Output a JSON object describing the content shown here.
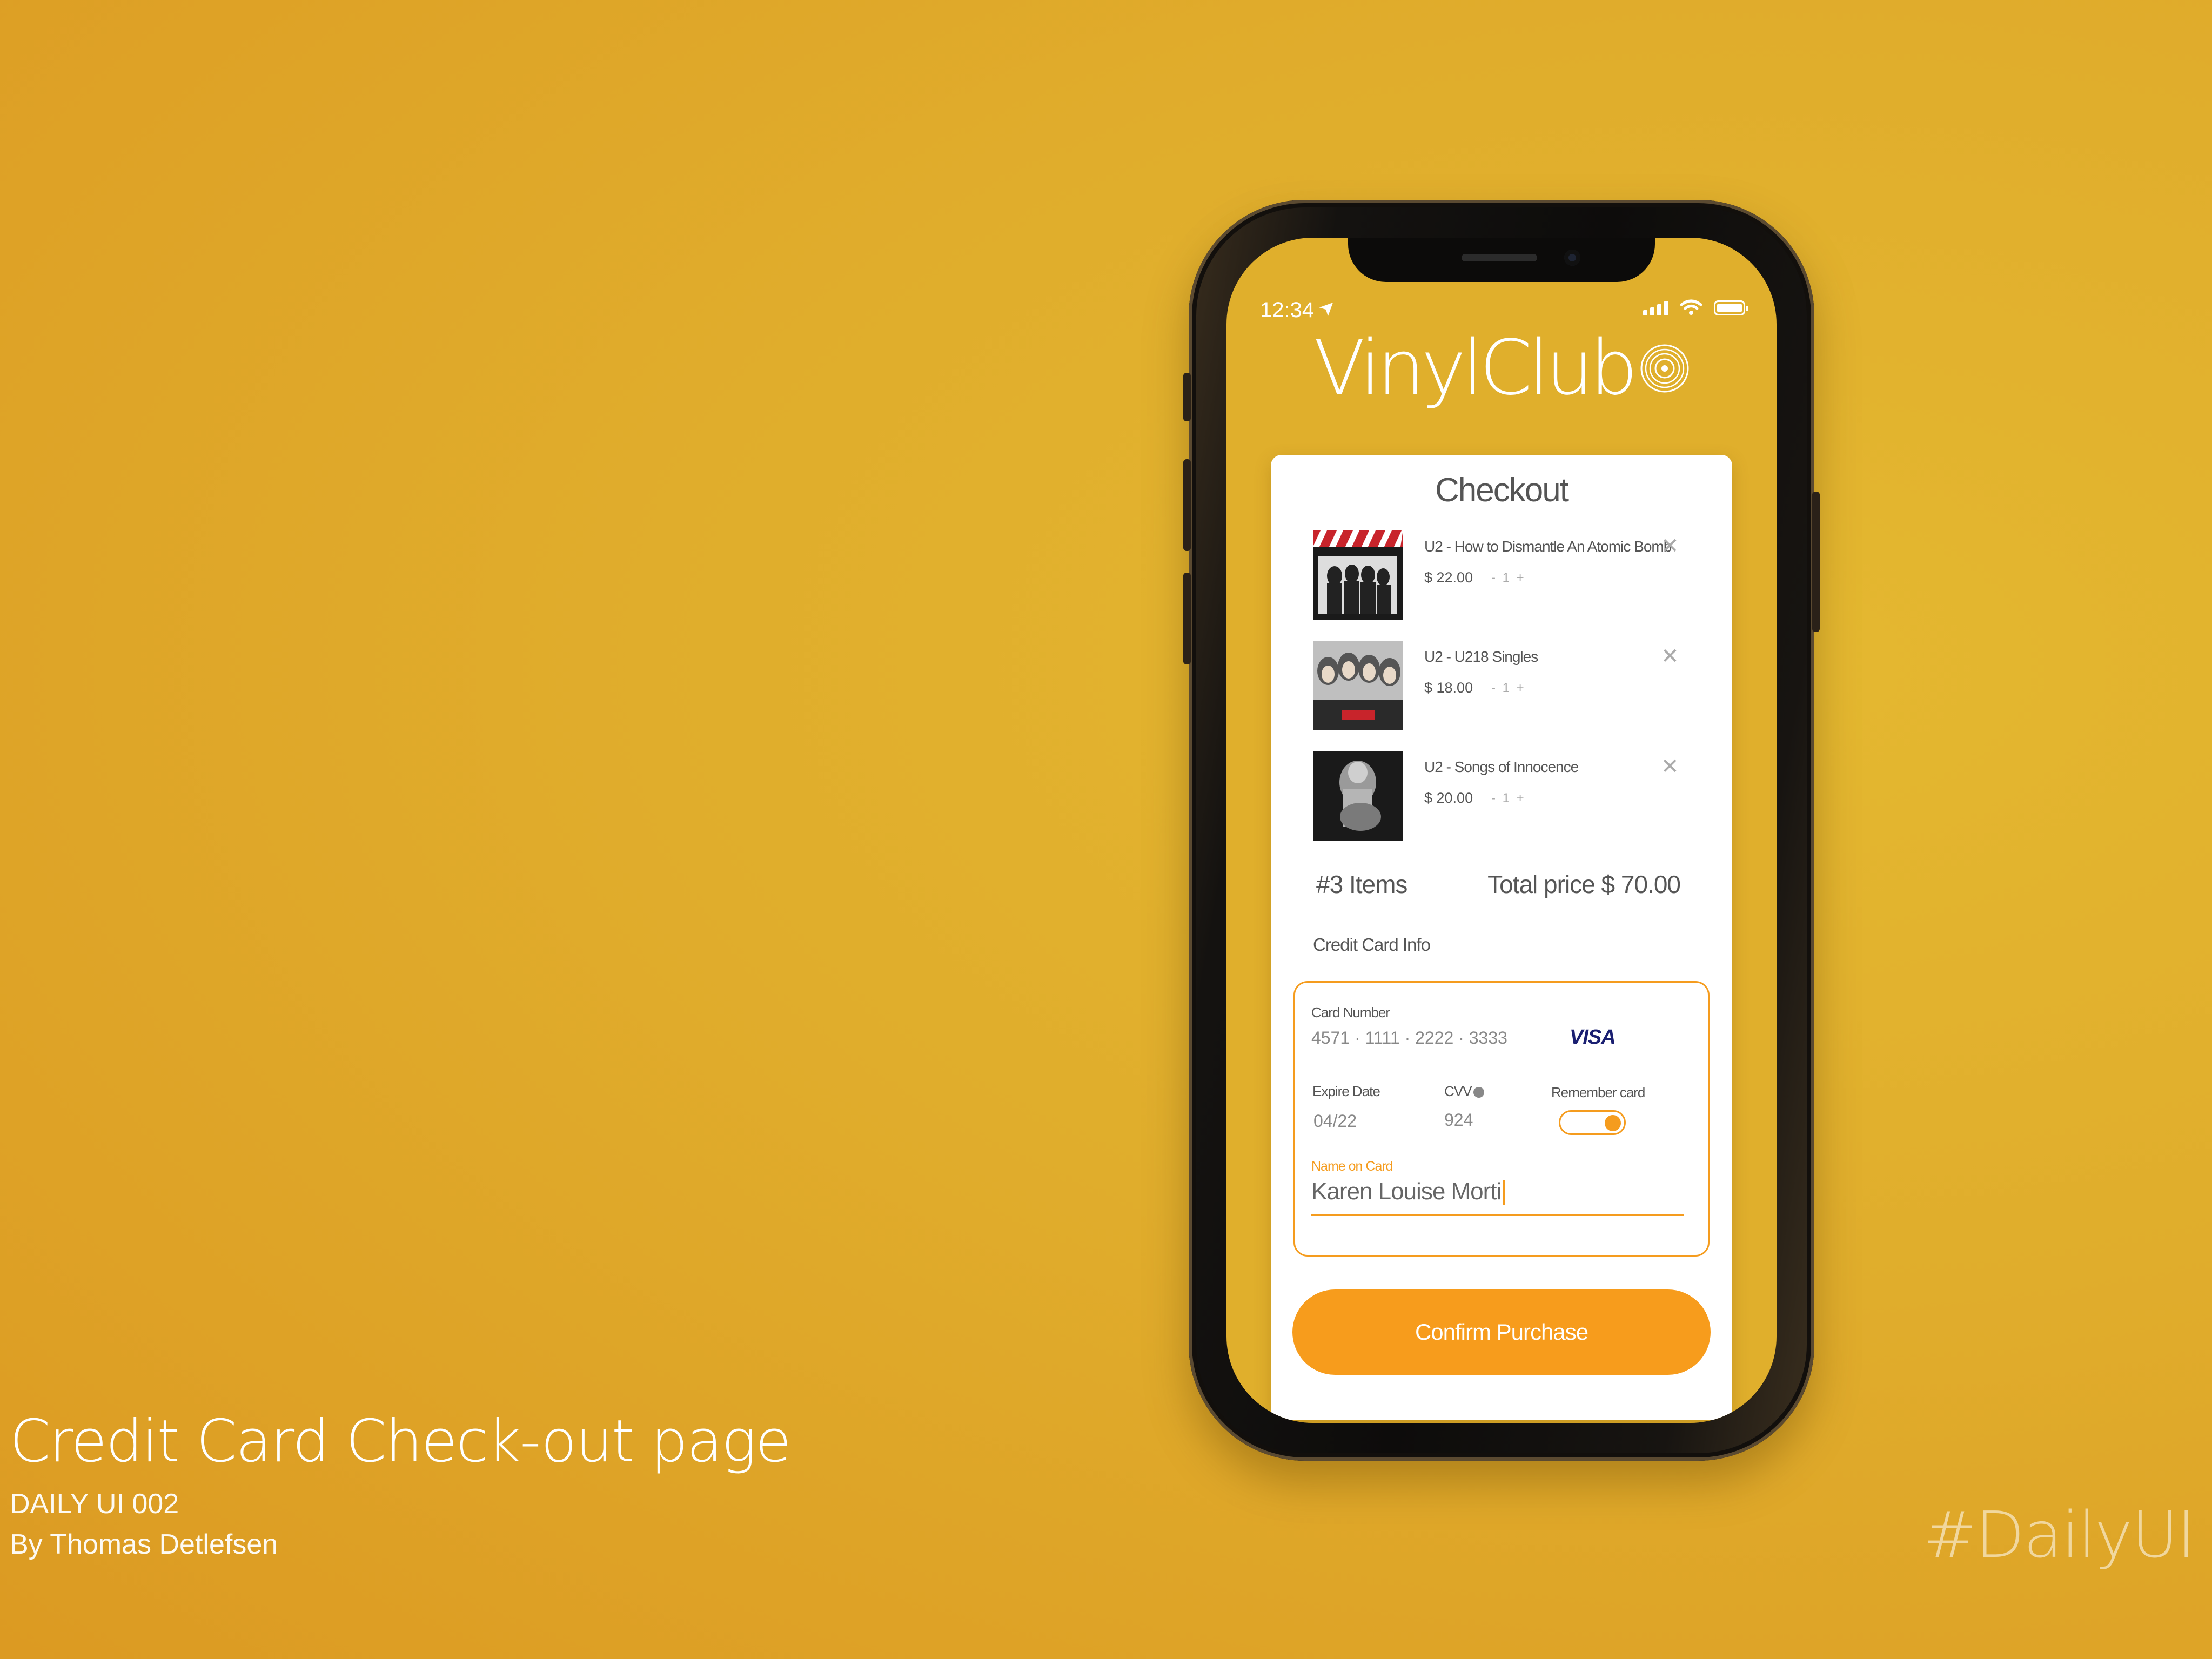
{
  "caption": {
    "title": "Credit Card Check-out page",
    "line1": "DAILY UI 002",
    "line2": "By Thomas Detlefsen"
  },
  "hashtag": "#DailyUI",
  "status_bar": {
    "time": "12:34",
    "location_glyph": "➤",
    "signal_bars": 4,
    "icons": [
      "signal-icon",
      "wifi-icon",
      "battery-icon"
    ]
  },
  "app": {
    "logo": "VinylClub",
    "logo_icon": "vinyl-disc-icon"
  },
  "checkout": {
    "title": "Checkout",
    "items": [
      {
        "name": "U2 - How to Dismantle An Atomic Bomb",
        "price": "$ 22.00",
        "qty": "- 1 +",
        "remove": "✕"
      },
      {
        "name": "U2 - U218 Singles",
        "price": "$ 18.00",
        "qty": "- 1 +",
        "remove": "✕"
      },
      {
        "name": "U2 - Songs of Innocence",
        "price": "$ 20.00",
        "qty": "- 1 +",
        "remove": "✕"
      }
    ],
    "item_count": "#3 Items",
    "total": "Total price $ 70.00",
    "cc_section_label": "Credit Card Info",
    "card": {
      "number_label": "Card Number",
      "number": "4571 · 1111 · 2222 · 3333",
      "brand": "VISA",
      "expire_label": "Expire Date",
      "expire": "04/22",
      "cvv_label": "CVV",
      "cvv": "924",
      "remember_label": "Remember card",
      "remember_on": true,
      "name_label": "Name on Card",
      "name_value": "Karen Louise Morti"
    },
    "confirm_label": "Confirm Purchase"
  },
  "colors": {
    "background": "#e0ad2c",
    "accent": "#f79c1c",
    "card": "#ffffff",
    "text": "#555555"
  }
}
